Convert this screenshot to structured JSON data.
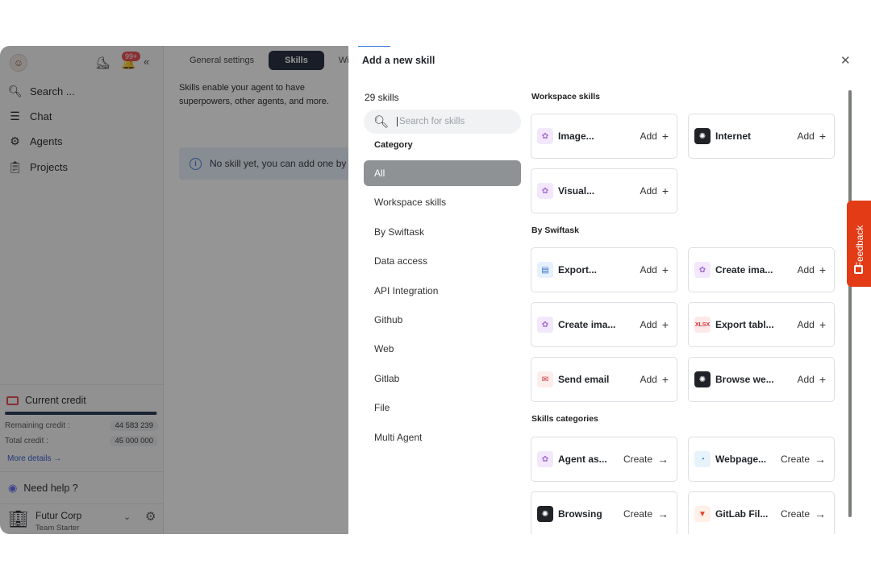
{
  "sidebar": {
    "notification_count": "99+",
    "nav": [
      {
        "label": "Search ...",
        "icon": "search-icon"
      },
      {
        "label": "Chat",
        "icon": "chat-icon"
      },
      {
        "label": "Agents",
        "icon": "robot-icon"
      },
      {
        "label": "Projects",
        "icon": "clipboard-icon"
      }
    ],
    "credit": {
      "title": "Current credit",
      "remaining_label": "Remaining credit :",
      "remaining_value": "44 583 239",
      "total_label": "Total credit :",
      "total_value": "45 000 000",
      "progress": 0.99,
      "more_details": "More details"
    },
    "need_help": "Need help ?",
    "workspace": {
      "name": "Futur Corp",
      "plan": "Team Starter"
    }
  },
  "main": {
    "tabs": [
      "General settings",
      "Skills",
      "Wi"
    ],
    "active_tab": "Skills",
    "description": "Skills enable your agent to have superpowers, other agents, and more.",
    "info": "No skill yet, you can add one by"
  },
  "panel": {
    "title": "Add a new skill",
    "skills_count": "29 skills",
    "search_placeholder": "Search for skills",
    "category_heading": "Category",
    "categories": [
      "All",
      "Workspace skills",
      "By Swiftask",
      "Data access",
      "API Integration",
      "Github",
      "Web",
      "Gitlab",
      "File",
      "Multi Agent"
    ],
    "active_category": "All",
    "sections": {
      "workspace": "Workspace skills",
      "swiftask": "By Swiftask",
      "categories": "Skills categories"
    },
    "cards": {
      "image": {
        "name": "Image...",
        "action": "Add"
      },
      "internet": {
        "name": "Internet",
        "action": "Add"
      },
      "visual": {
        "name": "Visual...",
        "action": "Add"
      },
      "export": {
        "name": "Export...",
        "action": "Add"
      },
      "create_ima_1": {
        "name": "Create ima...",
        "action": "Add"
      },
      "create_ima_2": {
        "name": "Create ima...",
        "action": "Add"
      },
      "export_tabl": {
        "name": "Export tabl...",
        "action": "Add"
      },
      "send_email": {
        "name": "Send email",
        "action": "Add"
      },
      "browse_we": {
        "name": "Browse we...",
        "action": "Add"
      },
      "agent_as": {
        "name": "Agent as...",
        "action": "Create"
      },
      "webpage": {
        "name": "Webpage...",
        "action": "Create"
      },
      "browsing": {
        "name": "Browsing",
        "action": "Create"
      },
      "gitlab_fil": {
        "name": "GitLab Fil...",
        "action": "Create"
      }
    },
    "xlsx_label": "XLSX"
  },
  "feedback_label": "Feedback"
}
